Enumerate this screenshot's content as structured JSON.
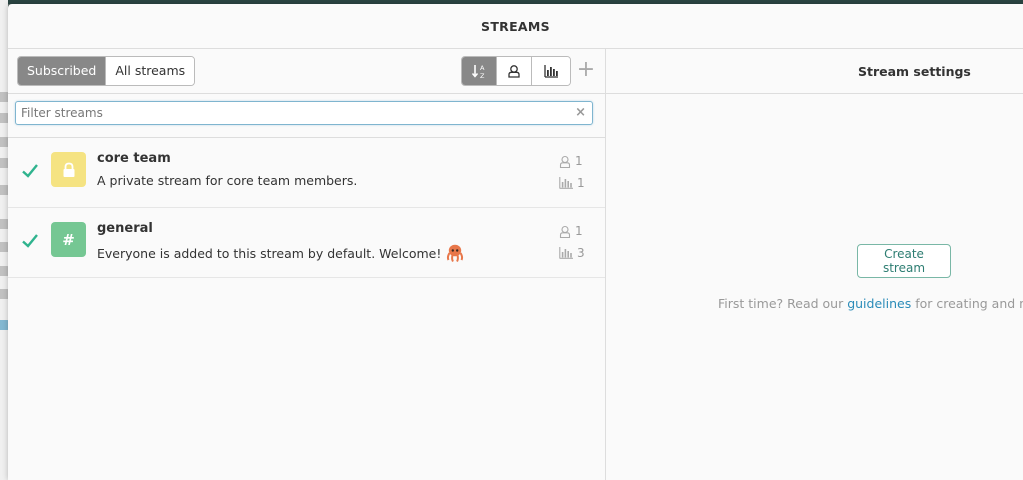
{
  "overlay": {
    "title": "STREAMS"
  },
  "tabs": [
    {
      "label": "Subscribed",
      "active": true
    },
    {
      "label": "All streams",
      "active": false
    }
  ],
  "sort_buttons": [
    {
      "icon": "sort-alphabetical-icon",
      "active": true
    },
    {
      "icon": "user-icon",
      "active": false
    },
    {
      "icon": "bar-chart-icon",
      "active": false
    }
  ],
  "add_button": {
    "label": "+"
  },
  "filter": {
    "placeholder": "Filter streams",
    "value": "",
    "clear": "×"
  },
  "streams": [
    {
      "name": "core team",
      "description": "A private stream for core team members.",
      "private": true,
      "color": "#f5e382",
      "subscribers": "1",
      "weekly_traffic": "1",
      "subscribed": true
    },
    {
      "name": "general",
      "description": "Everyone is added to this stream by default. Welcome!",
      "private": false,
      "color": "#75c793",
      "subscribers": "1",
      "weekly_traffic": "3",
      "subscribed": true,
      "emoji": "octopus-icon"
    }
  ],
  "settings": {
    "header": "Stream settings",
    "create_button": "Create stream",
    "first_time_prefix": "First time? Read our ",
    "guidelines_link": "guidelines",
    "first_time_suffix": " for creating and naming streams."
  },
  "colors": {
    "check": "#2fb38e",
    "link": "#2a8bb8",
    "tab_active": "#888888"
  }
}
